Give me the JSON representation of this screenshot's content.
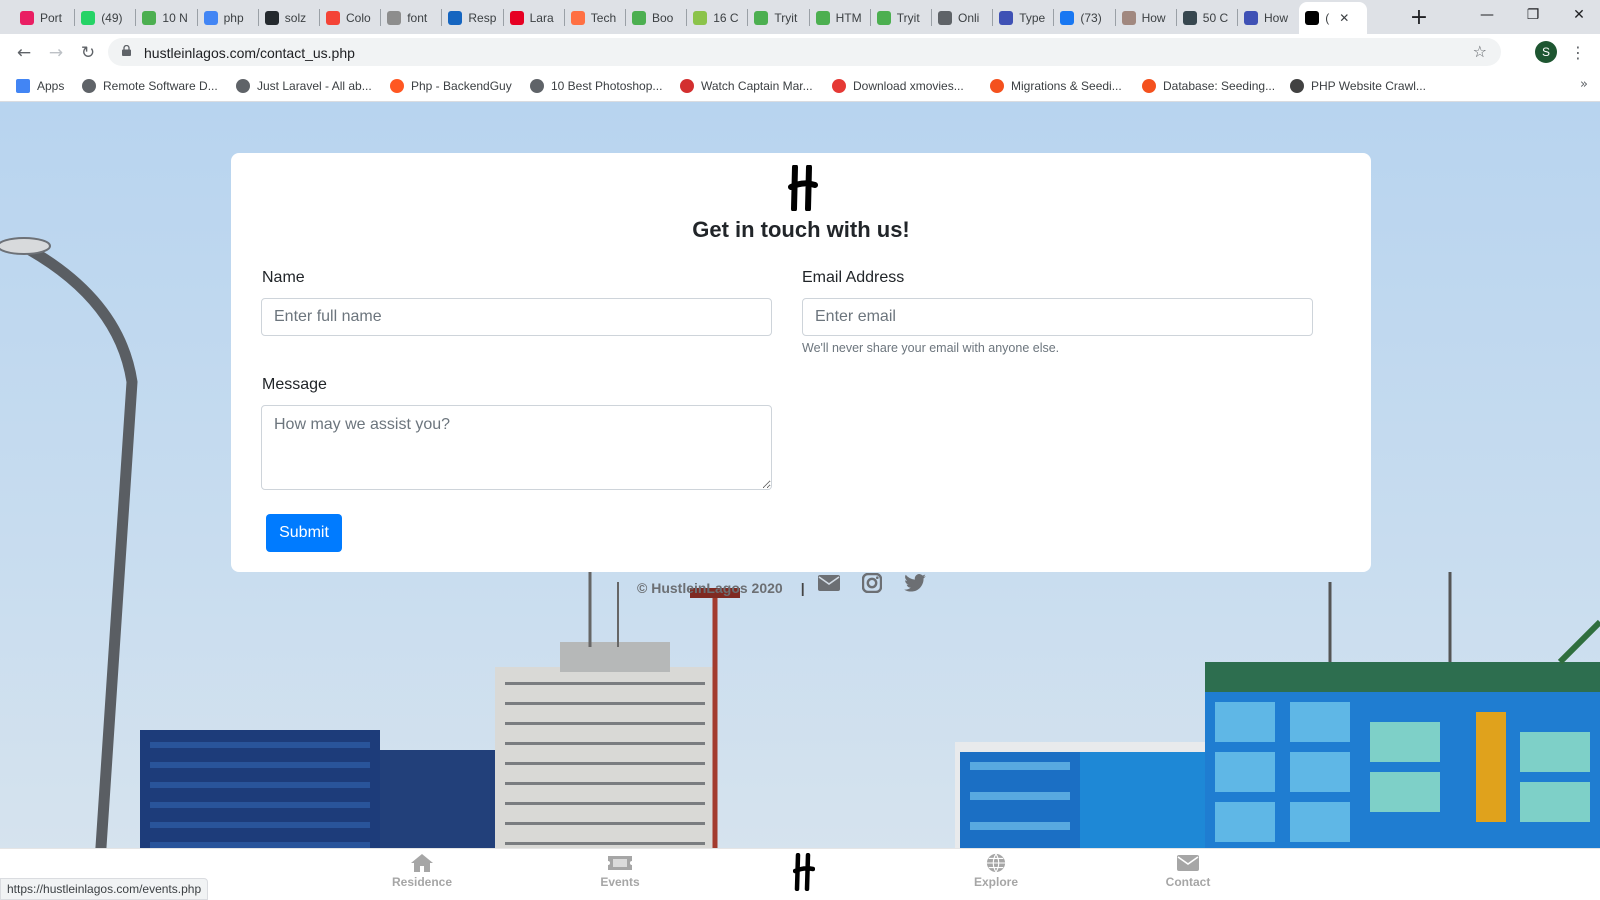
{
  "browser": {
    "tabs": [
      {
        "title": "Port",
        "icon": "pink-circle-icon",
        "color": "#e91e63"
      },
      {
        "title": "(49)",
        "icon": "whatsapp-icon",
        "color": "#25d366"
      },
      {
        "title": "10 N",
        "icon": "rainbow-icon",
        "color": "#4caf50"
      },
      {
        "title": "php",
        "icon": "google-icon",
        "color": "#4285f4"
      },
      {
        "title": "solz",
        "icon": "github-icon",
        "color": "#24292e"
      },
      {
        "title": "Colo",
        "icon": "colorzilla-icon",
        "color": "#f44336"
      },
      {
        "title": "font",
        "icon": "flag-icon",
        "color": "#8d8d8d"
      },
      {
        "title": "Resp",
        "icon": "blue-app-icon",
        "color": "#1565c0"
      },
      {
        "title": "Lara",
        "icon": "pinterest-icon",
        "color": "#e60023"
      },
      {
        "title": "Tech",
        "icon": "orange-site-icon",
        "color": "#ff7043"
      },
      {
        "title": "Boo",
        "icon": "w3schools-icon",
        "color": "#4caf50"
      },
      {
        "title": "16 C",
        "icon": "green-pin-icon",
        "color": "#8bc34a"
      },
      {
        "title": "Tryit",
        "icon": "w3schools-icon",
        "color": "#4caf50"
      },
      {
        "title": "HTM",
        "icon": "w3schools-icon",
        "color": "#4caf50"
      },
      {
        "title": "Tryit",
        "icon": "w3schools-icon",
        "color": "#4caf50"
      },
      {
        "title": "Onli",
        "icon": "globe-icon",
        "color": "#5f6368"
      },
      {
        "title": "Type",
        "icon": "webflow-icon",
        "color": "#3f51b5"
      },
      {
        "title": "(73)",
        "icon": "facebook-icon",
        "color": "#1877f2"
      },
      {
        "title": "How",
        "icon": "avatar-icon",
        "color": "#a1887f"
      },
      {
        "title": "50 C",
        "icon": "gallery-icon",
        "color": "#37474f"
      },
      {
        "title": "How",
        "icon": "webflow-icon",
        "color": "#3f51b5"
      },
      {
        "title": "(",
        "icon": "hustle-logo-icon",
        "color": "#000000"
      }
    ],
    "active_tab_index": 21,
    "new_tab_label": "+",
    "url": "hustleinlagos.com/contact_us.php",
    "profile_initial": "S",
    "bookmarks": [
      {
        "label": "Apps",
        "icon": "apps-grid-icon",
        "color": "#4285f4"
      },
      {
        "label": "Remote Software D...",
        "icon": "globe-icon",
        "color": "#5f6368"
      },
      {
        "label": "Just Laravel - All ab...",
        "icon": "globe-icon",
        "color": "#5f6368"
      },
      {
        "label": "Php - BackendGuy",
        "icon": "flame-icon",
        "color": "#ff5722"
      },
      {
        "label": "10 Best Photoshop...",
        "icon": "globe-icon",
        "color": "#5f6368"
      },
      {
        "label": "Watch Captain Mar...",
        "icon": "x-circle-icon",
        "color": "#d32f2f"
      },
      {
        "label": "Download xmovies...",
        "icon": "download-icon",
        "color": "#e53935"
      },
      {
        "label": "Migrations & Seedi...",
        "icon": "laravel-icon",
        "color": "#f4511e"
      },
      {
        "label": "Database: Seeding...",
        "icon": "laravel-icon",
        "color": "#f4511e"
      },
      {
        "label": "PHP Website Crawl...",
        "icon": "crawler-icon",
        "color": "#424242"
      }
    ],
    "status_url": "https://hustleinlagos.com/events.php"
  },
  "form": {
    "heading": "Get in touch with us!",
    "name_label": "Name",
    "name_placeholder": "Enter full name",
    "email_label": "Email Address",
    "email_placeholder": "Enter email",
    "email_help": "We'll never share your email with anyone else.",
    "message_label": "Message",
    "message_placeholder": "How may we assist you?",
    "submit_label": "Submit",
    "submit_color": "#007bff"
  },
  "footer": {
    "copyright": "© HustleinLagos 2020",
    "separator": "|",
    "icons": [
      "envelope-icon",
      "instagram-icon",
      "twitter-icon"
    ]
  },
  "bottom_nav": {
    "items": [
      {
        "label": "Residence",
        "icon": "home-icon"
      },
      {
        "label": "Events",
        "icon": "ticket-icon"
      },
      {
        "label": "Explore",
        "icon": "globe-icon"
      },
      {
        "label": "Contact",
        "icon": "envelope-icon"
      }
    ],
    "center_icon": "hustle-logo-icon"
  }
}
